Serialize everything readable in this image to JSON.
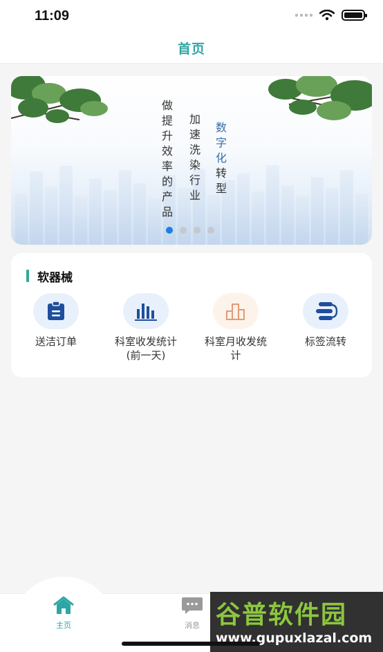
{
  "status_bar": {
    "time": "11:09"
  },
  "nav": {
    "title": "首页"
  },
  "banner": {
    "text_col1": "做提升效率的产品",
    "text_col2": "加速洗染行业",
    "text_col3_accent": "数字化",
    "text_col3_rest": "转型",
    "carousel_total": 4,
    "carousel_active": 1
  },
  "section": {
    "title": "软器械",
    "items": [
      {
        "label": "送洁订单",
        "icon": "clipboard-icon"
      },
      {
        "label": "科室收发统计\n(前一天)",
        "icon": "bar-chart-icon"
      },
      {
        "label": "科室月收发统\n计",
        "icon": "column-chart-icon"
      },
      {
        "label": "标签流转",
        "icon": "tag-flow-icon"
      }
    ]
  },
  "tabbar": {
    "home_label": "主页",
    "message_label": "消息"
  },
  "watermark": {
    "title": "谷普软件园",
    "url": "www.gupuxlazal.com"
  },
  "colors": {
    "accent": "#2ea6a6",
    "icon_blue": "#1f4f9c",
    "icon_orange": "#e29a78",
    "dot_active": "#1f7fe0"
  }
}
